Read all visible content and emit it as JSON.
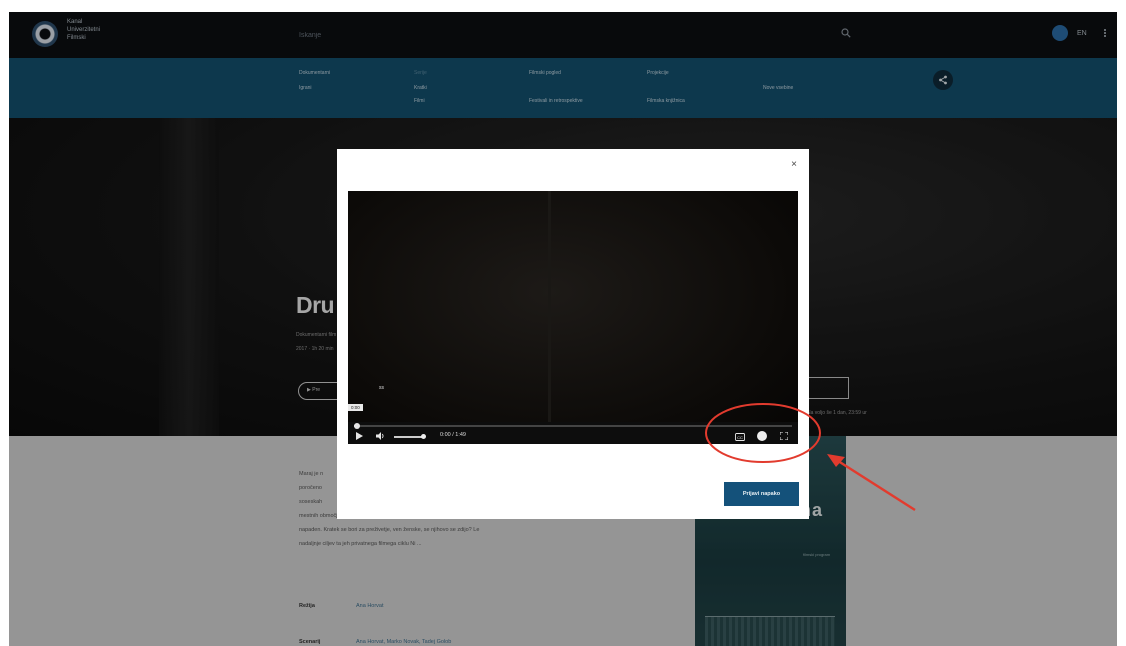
{
  "header": {
    "logo_line1": "Kanal",
    "logo_line2": "Univerzitetni",
    "logo_line3": "Filmski",
    "search_placeholder": "Iskanje",
    "lang": "EN"
  },
  "nav": {
    "col1": [
      "Dokumentarni",
      "Igrani"
    ],
    "col2": [
      "Serije",
      "Kratki",
      "Filmi"
    ],
    "col3": [
      "Filmski pogled",
      "Festivali in retrospektive"
    ],
    "col4": [
      "Projekcije",
      "Filmska knjižnica"
    ],
    "col5": [
      "Nove vsebine"
    ]
  },
  "hero": {
    "title": "Dru",
    "subtitle": "Dokumentarni film",
    "meta": "2017 · 1h 20 min",
    "play_label": "Pre",
    "availability": "Na voljo še 1 dan, 23:59 ur"
  },
  "description": [
    "Maraj je n",
    "poročeno",
    "soseskah",
    "mestnih območjih, kjer ni nobena izmed obeh strani in vzorci, pred katero pobeg",
    "napaden. Kratek se bori za preživetje, ven ženske, se njihovo se zdijo? Le",
    "nadaljnje ciljev ta jeh privatnega filmega ciklu Ni ..."
  ],
  "info": {
    "rows": [
      {
        "key": "Režija",
        "value": "Ana Horvat"
      },
      {
        "key": "Scenarij",
        "value": "Ana Horvat, Marko Novak, Tadej Golob"
      }
    ]
  },
  "poster": {
    "title": "na",
    "sub": "filmski program"
  },
  "modal": {
    "close_label": "×",
    "subtitle_text": "ss",
    "tooltip_time": "0:00",
    "time_display": "0:00 / 1:49",
    "cc_label": "CC",
    "confirm_label": "Prijavi napako"
  },
  "colors": {
    "navbar": "#13516f",
    "primary": "#14517a",
    "annotation": "#e23b2e"
  },
  "progress": {
    "seek_fraction": 0.01,
    "volume_fraction": 1.0
  }
}
